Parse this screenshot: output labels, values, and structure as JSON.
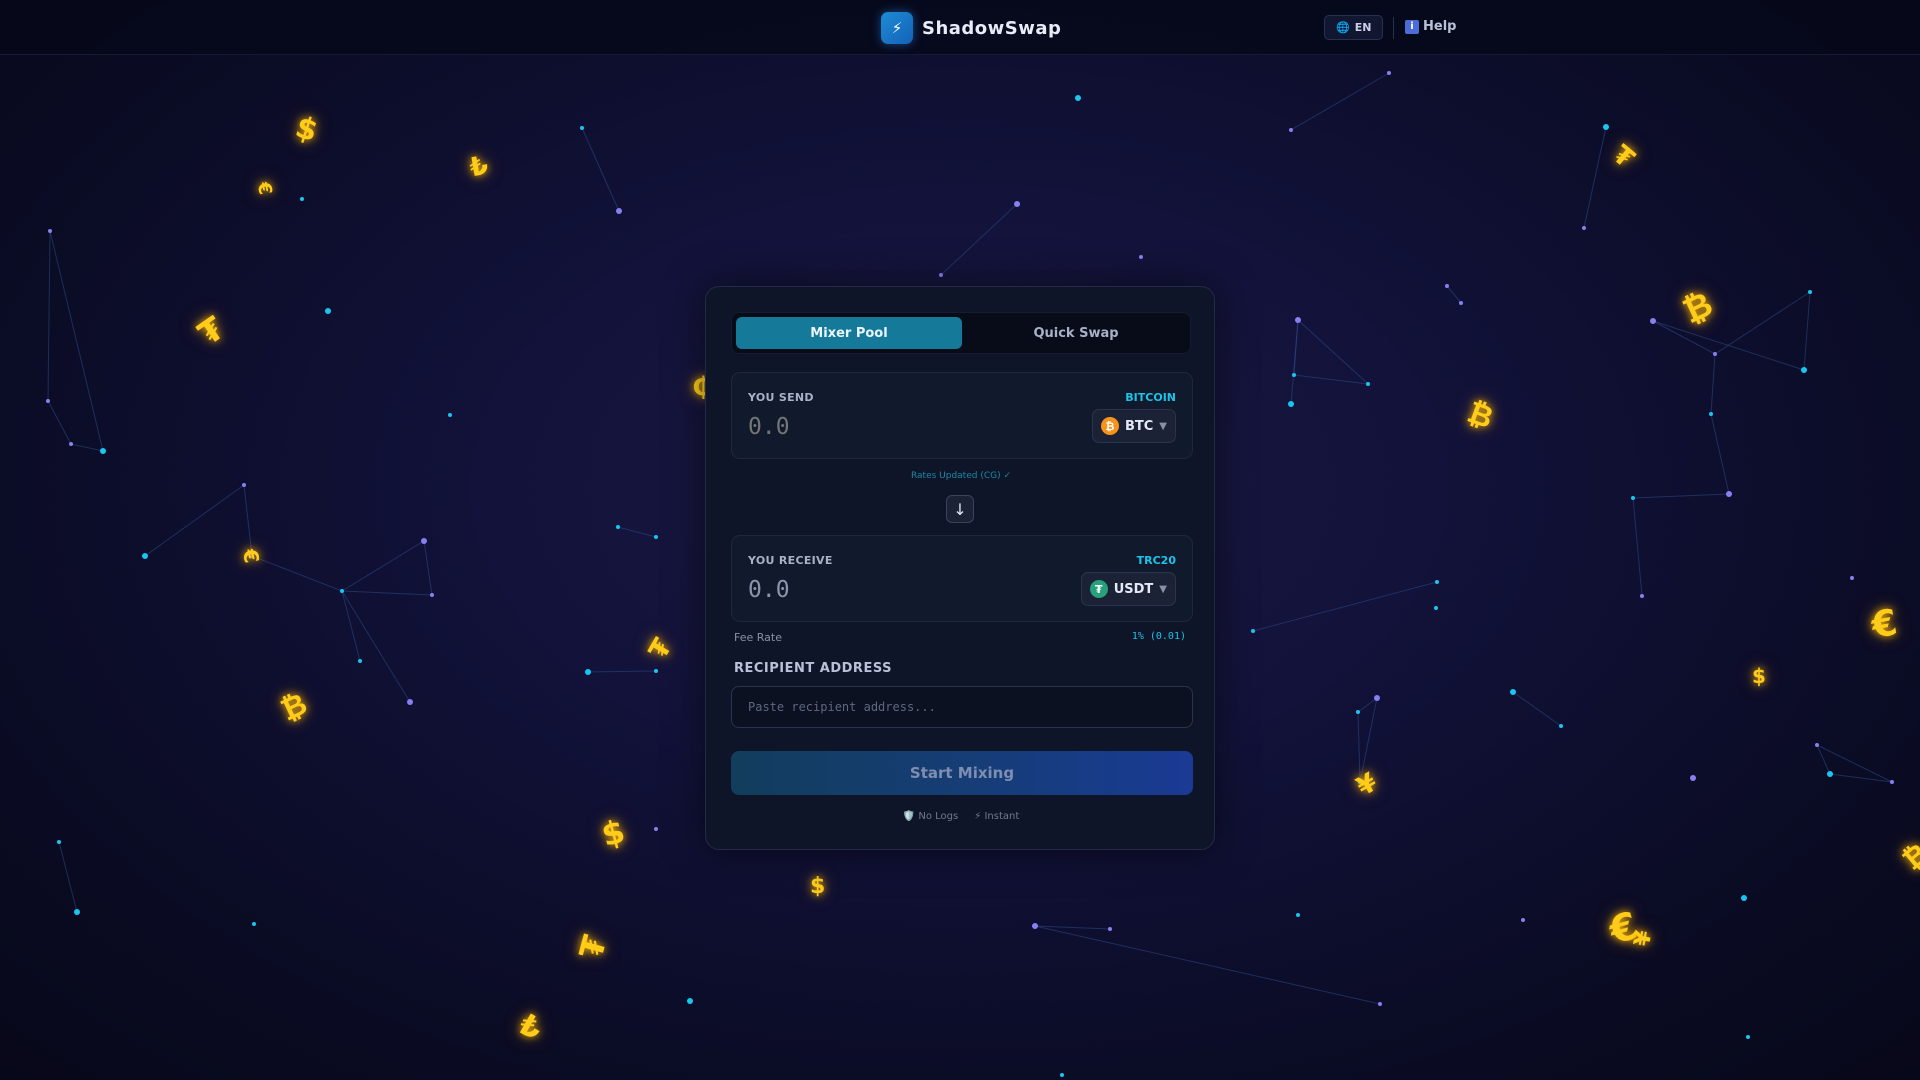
{
  "header": {
    "brand_icon": "lightning-bolt-icon",
    "brand_name": "ShadowSwap",
    "lang_icon": "globe-icon",
    "lang_label": "EN",
    "help_icon": "info-icon",
    "help_label": "Help"
  },
  "tabs": [
    {
      "label": "Mixer Pool",
      "active": true
    },
    {
      "label": "Quick Swap",
      "active": false
    }
  ],
  "send": {
    "label": "YOU SEND",
    "network": "BITCOIN",
    "amount_placeholder": "0.0",
    "coin_icon": "bitcoin-icon",
    "coin": "BTC"
  },
  "rates_note": "Rates Updated (CG) ✓",
  "receive": {
    "label": "YOU RECEIVE",
    "network": "TRC20",
    "amount": "0.0",
    "coin_icon": "tether-icon",
    "coin": "USDT"
  },
  "fee": {
    "label": "Fee Rate",
    "value": "1% (0.01)"
  },
  "recipient": {
    "label": "RECIPIENT ADDRESS",
    "placeholder": "Paste recipient address..."
  },
  "start_button": "Start Mixing",
  "badges": [
    {
      "icon": "shield-icon",
      "label": "No Logs"
    },
    {
      "icon": "lightning-icon",
      "label": "Instant"
    }
  ],
  "colors": {
    "accent": "#157a99",
    "network_text": "#1cc3e8",
    "background": "#12123a",
    "currency_glyph": "#ffcc1a"
  }
}
